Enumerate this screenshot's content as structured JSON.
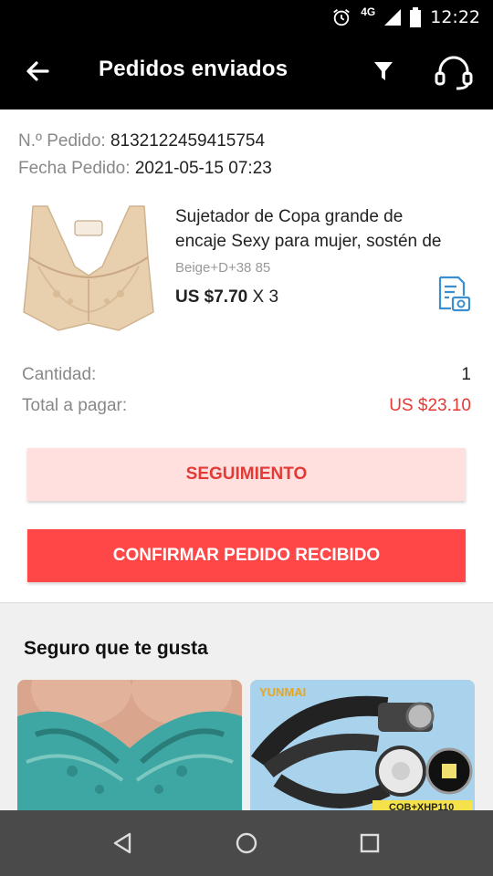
{
  "status_bar": {
    "network": "4G",
    "time": "12:22"
  },
  "app_bar": {
    "title": "Pedidos enviados"
  },
  "order": {
    "number_label": "N.º Pedido:",
    "number_value": "8132122459415754",
    "date_label": "Fecha Pedido:",
    "date_value": "2021-05-15 07:23"
  },
  "product": {
    "title_line1": "Sujetador de Copa grande de",
    "title_line2": "encaje Sexy para mujer, sostén de",
    "variant": "Beige+D+38 85",
    "price": "US $7.70",
    "quantity_text": "X 3",
    "image_icon": "bra-product-image",
    "snapshot_icon": "document-camera-icon"
  },
  "summary": {
    "quantity_label": "Cantidad:",
    "quantity_value": "1",
    "total_label": "Total a pagar:",
    "total_value": "US $23.10"
  },
  "buttons": {
    "track_label": "SEGUIMIENTO",
    "confirm_label": "CONFIRMAR PEDIDO RECIBIDO"
  },
  "recommendations": {
    "title": "Seguro que te gusta",
    "items": [
      {
        "image": "teal-lace-bra-photo"
      },
      {
        "image": "headlamp-photo",
        "brand_text": "YUNMAI",
        "badge_text": "COB+XHP110"
      }
    ]
  },
  "colors": {
    "accent_red": "#ff4747",
    "price_red": "#e53935",
    "track_bg": "#ffe0de",
    "bar_black": "#000000"
  }
}
